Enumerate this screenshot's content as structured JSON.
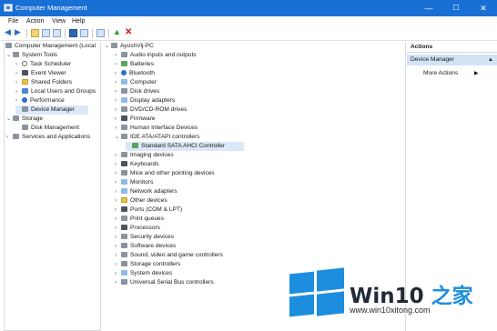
{
  "window": {
    "title": "Computer Management",
    "minimize": "—",
    "maximize": "☐",
    "close": "✕"
  },
  "menu": [
    "File",
    "Action",
    "View",
    "Help"
  ],
  "left_tree": [
    {
      "label": "Computer Management (Local",
      "icon": "computer-management-icon",
      "exp": "",
      "level": 0
    },
    {
      "label": "System Tools",
      "icon": "system-tools-icon",
      "exp": "⌄",
      "level": 1
    },
    {
      "label": "Task Scheduler",
      "icon": "clock-icon",
      "exp": "›",
      "level": 2
    },
    {
      "label": "Event Viewer",
      "icon": "event-viewer-icon",
      "exp": "›",
      "level": 2
    },
    {
      "label": "Shared Folders",
      "icon": "folder-icon",
      "exp": "›",
      "level": 2
    },
    {
      "label": "Local Users and Groups",
      "icon": "users-icon",
      "exp": "›",
      "level": 2
    },
    {
      "label": "Performance",
      "icon": "performance-icon",
      "exp": "›",
      "level": 2
    },
    {
      "label": "Device Manager",
      "icon": "device-manager-icon",
      "exp": "",
      "level": 2,
      "selected": true
    },
    {
      "label": "Storage",
      "icon": "storage-icon",
      "exp": "⌄",
      "level": 1
    },
    {
      "label": "Disk Management",
      "icon": "disk-icon",
      "exp": "",
      "level": 2
    },
    {
      "label": "Services and Applications",
      "icon": "services-icon",
      "exp": "›",
      "level": 1
    }
  ],
  "device_tree": {
    "root": "AyushVij-PC",
    "items": [
      {
        "label": "Audio inputs and outputs",
        "icon": "speaker-icon",
        "exp": "›"
      },
      {
        "label": "Batteries",
        "icon": "battery-icon",
        "exp": "›"
      },
      {
        "label": "Bluetooth",
        "icon": "bluetooth-icon",
        "exp": "›"
      },
      {
        "label": "Computer",
        "icon": "computer-icon",
        "exp": "›"
      },
      {
        "label": "Disk drives",
        "icon": "disk-drive-icon",
        "exp": "›"
      },
      {
        "label": "Display adapters",
        "icon": "display-adapter-icon",
        "exp": "›"
      },
      {
        "label": "DVD/CD-ROM drives",
        "icon": "dvd-icon",
        "exp": "›"
      },
      {
        "label": "Firmware",
        "icon": "firmware-icon",
        "exp": "›"
      },
      {
        "label": "Human Interface Devices",
        "icon": "hid-icon",
        "exp": "›"
      },
      {
        "label": "IDE ATA/ATAPI controllers",
        "icon": "ide-controller-icon",
        "exp": "⌄"
      },
      {
        "label": "Standard SATA AHCI Controller",
        "icon": "sata-controller-icon",
        "exp": "",
        "child": true,
        "selected": true
      },
      {
        "label": "Imaging devices",
        "icon": "camera-icon",
        "exp": "›"
      },
      {
        "label": "Keyboards",
        "icon": "keyboard-icon",
        "exp": "›"
      },
      {
        "label": "Mice and other pointing devices",
        "icon": "mouse-icon",
        "exp": "›"
      },
      {
        "label": "Monitors",
        "icon": "monitor-icon",
        "exp": "›"
      },
      {
        "label": "Network adapters",
        "icon": "network-adapter-icon",
        "exp": "›"
      },
      {
        "label": "Other devices",
        "icon": "other-devices-icon",
        "exp": "›"
      },
      {
        "label": "Ports (COM & LPT)",
        "icon": "port-icon",
        "exp": "›"
      },
      {
        "label": "Print queues",
        "icon": "printer-icon",
        "exp": "›"
      },
      {
        "label": "Processors",
        "icon": "processor-icon",
        "exp": "›"
      },
      {
        "label": "Security devices",
        "icon": "security-device-icon",
        "exp": "›"
      },
      {
        "label": "Software devices",
        "icon": "software-device-icon",
        "exp": "›"
      },
      {
        "label": "Sound, video and game controllers",
        "icon": "sound-icon",
        "exp": "›"
      },
      {
        "label": "Storage controllers",
        "icon": "storage-controller-icon",
        "exp": "›"
      },
      {
        "label": "System devices",
        "icon": "system-device-icon",
        "exp": "›"
      },
      {
        "label": "Universal Serial Bus controllers",
        "icon": "usb-icon",
        "exp": "›"
      }
    ]
  },
  "actions": {
    "header": "Actions",
    "section": "Device Manager",
    "item": "More Actions"
  },
  "watermark": {
    "brand_a": "Win10",
    "brand_b": " 之家",
    "url": "www.win10xitong.com"
  },
  "colors": {
    "titlebar": "#1a6fd4",
    "selection": "#dbe8f8",
    "action_selection": "#d3e3f6",
    "logo_blue": "#1d8ede"
  }
}
